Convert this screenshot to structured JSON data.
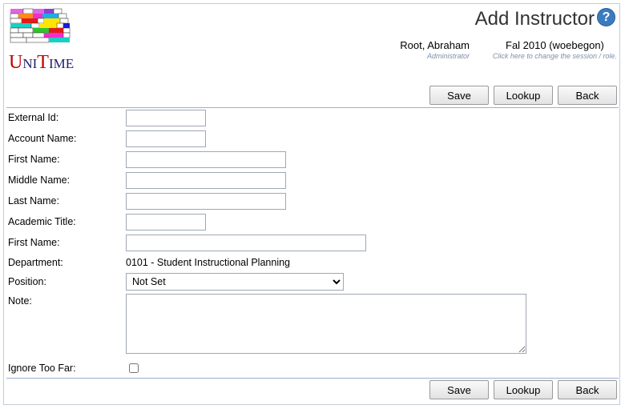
{
  "app": {
    "logo_text_u": "U",
    "logo_text_ni": "NI",
    "logo_text_t": "T",
    "logo_text_ime": "IME"
  },
  "header": {
    "title": "Add Instructor",
    "help_glyph": "?",
    "user_name": "Root, Abraham",
    "user_role": "Administrator",
    "session_name": "Fal 2010 (woebegon)",
    "session_hint": "Click here to change the session / role."
  },
  "buttons": {
    "save": "Save",
    "lookup": "Lookup",
    "back": "Back"
  },
  "form": {
    "external_id": {
      "label": "External Id:",
      "value": ""
    },
    "account_name": {
      "label": "Account Name:",
      "value": ""
    },
    "first_name": {
      "label": "First Name:",
      "value": ""
    },
    "middle_name": {
      "label": "Middle Name:",
      "value": ""
    },
    "last_name": {
      "label": "Last Name:",
      "value": ""
    },
    "academic_title": {
      "label": "Academic Title:",
      "value": ""
    },
    "first_name_2": {
      "label": "First Name:",
      "value": ""
    },
    "department": {
      "label": "Department:",
      "value": "0101 - Student Instructional Planning"
    },
    "position": {
      "label": "Position:",
      "selected": "Not Set"
    },
    "note": {
      "label": "Note:",
      "value": ""
    },
    "ignore_too_far": {
      "label": "Ignore Too Far:",
      "checked": false
    }
  },
  "colors": {
    "accent_blue": "#3b7bbf",
    "separator": "#9cb0ce",
    "logo_red": "#c20000",
    "logo_navy": "#1c1c6e"
  }
}
